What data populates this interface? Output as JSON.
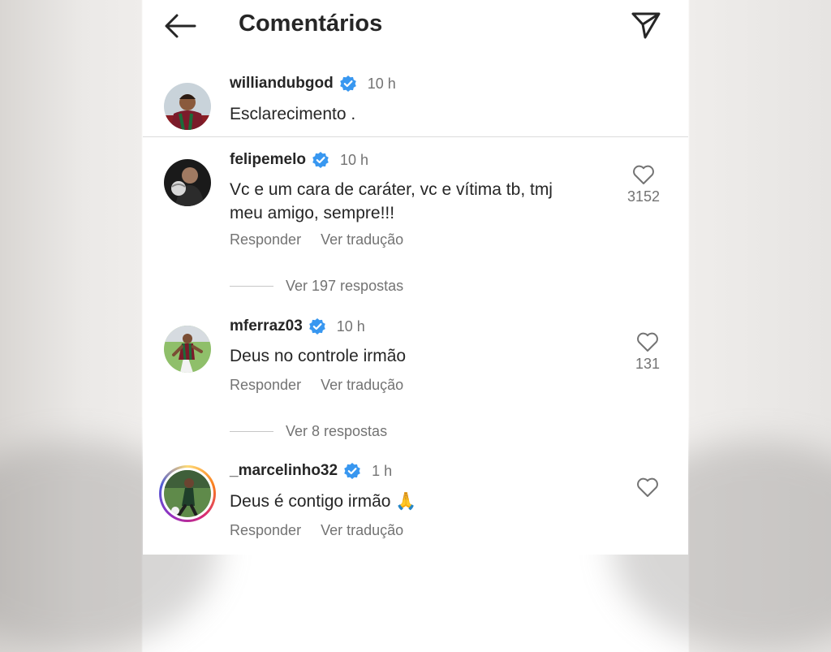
{
  "header": {
    "title": "Comentários"
  },
  "caption": {
    "username": "williandubgod",
    "time": "10 h",
    "text": "Esclarecimento ."
  },
  "comments": [
    {
      "username": "felipemelo",
      "time": "10 h",
      "text_line1": "Vc e um cara de caráter, vc e vítima tb, tmj",
      "text_line2": "meu amigo, sempre!!!",
      "likes": "3152",
      "reply_label": "Responder",
      "translate_label": "Ver tradução",
      "view_replies": "Ver 197 respostas"
    },
    {
      "username": "mferraz03",
      "time": "10 h",
      "text_line1": "Deus no controle irmão",
      "likes": "131",
      "reply_label": "Responder",
      "translate_label": "Ver tradução",
      "view_replies": "Ver 8 respostas"
    },
    {
      "username": "_marcelinho32",
      "time": "1 h",
      "text_line1": "Deus é contigo irmão 🙏",
      "reply_label": "Responder",
      "translate_label": "Ver tradução"
    }
  ],
  "icons": {
    "back": "arrow-left-icon",
    "send": "paper-plane-icon",
    "verified": "verified-badge-icon",
    "like": "heart-outline-icon"
  },
  "colors": {
    "verified": "#3897f0",
    "secondary_text": "#737373",
    "primary_text": "#262626"
  }
}
